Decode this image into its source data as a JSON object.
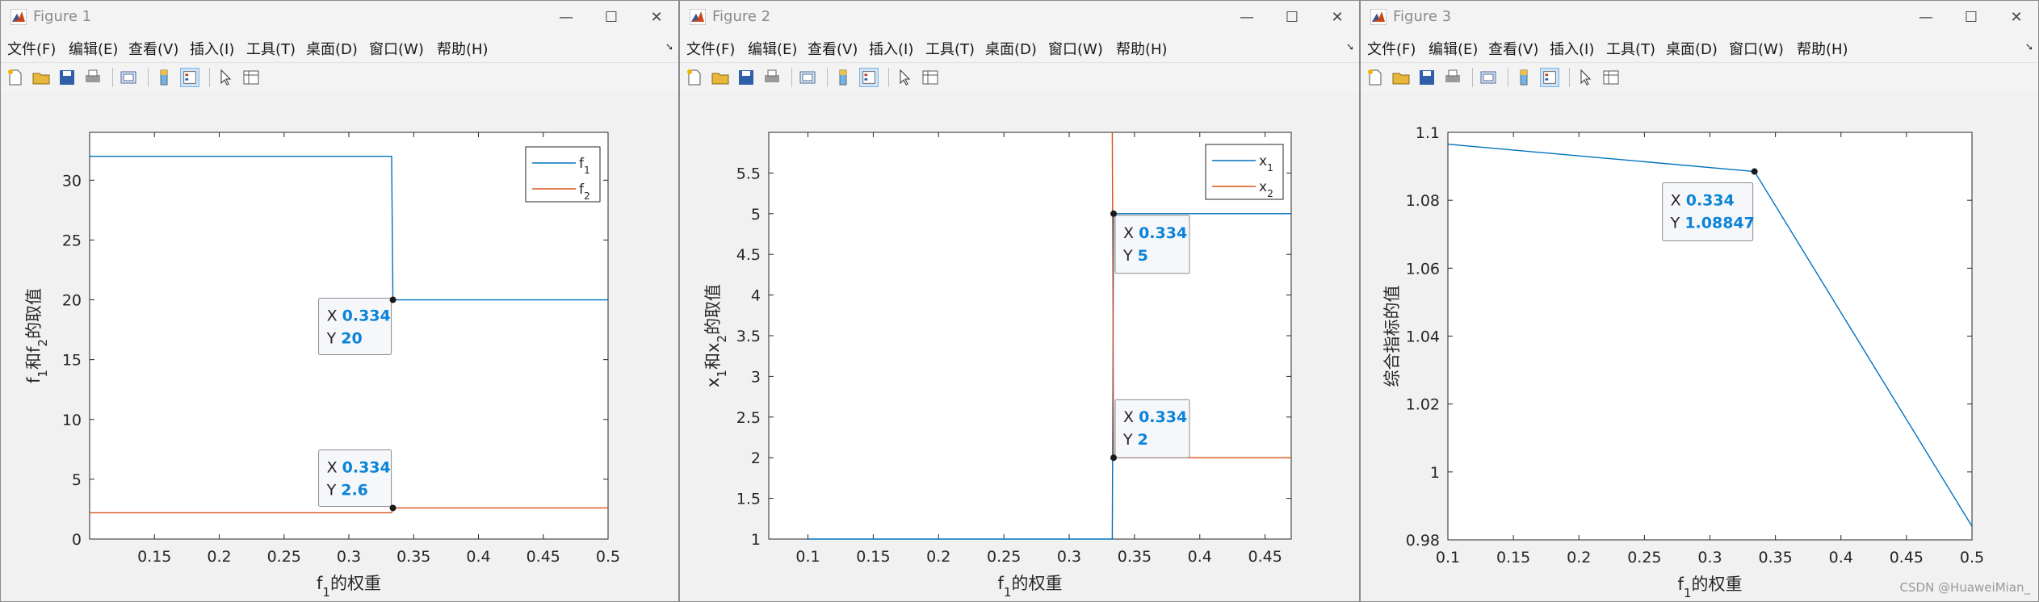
{
  "figures": [
    {
      "title": "Figure 1",
      "menu": [
        "文件(F)",
        "编辑(E)",
        "查看(V)",
        "插入(I)",
        "工具(T)",
        "桌面(D)",
        "窗口(W)",
        "帮助(H)"
      ],
      "xlabel_main": "f",
      "xlabel_sub": "1",
      "xlabel_rest": "的权重",
      "ylabel_parts": [
        [
          "f",
          "1"
        ],
        [
          "和f",
          "2"
        ],
        [
          "的取值",
          ""
        ]
      ],
      "legend": [
        [
          "f",
          "1"
        ],
        [
          "f",
          "2"
        ]
      ],
      "tips": [
        {
          "x_label": "X",
          "x_value": "0.334",
          "y_label": "Y",
          "y_value": "20"
        },
        {
          "x_label": "X",
          "x_value": "0.334",
          "y_label": "Y",
          "y_value": "2.6"
        }
      ]
    },
    {
      "title": "Figure 2",
      "menu": [
        "文件(F)",
        "编辑(E)",
        "查看(V)",
        "插入(I)",
        "工具(T)",
        "桌面(D)",
        "窗口(W)",
        "帮助(H)"
      ],
      "xlabel_main": "f",
      "xlabel_sub": "1",
      "xlabel_rest": "的权重",
      "ylabel_parts": [
        [
          "x",
          "1"
        ],
        [
          "和x",
          "2"
        ],
        [
          "的取值",
          ""
        ]
      ],
      "legend": [
        [
          "x",
          "1"
        ],
        [
          "x",
          "2"
        ]
      ],
      "tips": [
        {
          "x_label": "X",
          "x_value": "0.334",
          "y_label": "Y",
          "y_value": "5"
        },
        {
          "x_label": "X",
          "x_value": "0.334",
          "y_label": "Y",
          "y_value": "2"
        }
      ]
    },
    {
      "title": "Figure 3",
      "menu": [
        "文件(F)",
        "编辑(E)",
        "查看(V)",
        "插入(I)",
        "工具(T)",
        "桌面(D)",
        "窗口(W)",
        "帮助(H)"
      ],
      "xlabel_main": "f",
      "xlabel_sub": "1",
      "xlabel_rest": "的权重",
      "ylabel_parts": [
        [
          "综合指标的值",
          ""
        ]
      ],
      "legend": [],
      "tips": [
        {
          "x_label": "X",
          "x_value": "0.334",
          "y_label": "Y",
          "y_value": "1.08847"
        }
      ]
    }
  ],
  "colors": {
    "series1": "#0072BD",
    "series2": "#D95319",
    "tip_value": "#0a84d8"
  },
  "watermark": "CSDN @HuaweiMian_",
  "chart_data": [
    {
      "type": "line",
      "xlim": [
        0.1,
        0.5
      ],
      "ylim": [
        0,
        34
      ],
      "xticks": [
        "0.15",
        "0.2",
        "0.25",
        "0.3",
        "0.35",
        "0.4",
        "0.45",
        "0.5"
      ],
      "yticks": [
        "0",
        "5",
        "10",
        "15",
        "20",
        "25",
        "30"
      ],
      "legend_position": "top-right",
      "series": [
        {
          "name": "f1",
          "x": [
            0.1,
            0.333,
            0.334,
            0.5
          ],
          "y": [
            32,
            32,
            20,
            20
          ]
        },
        {
          "name": "f2",
          "x": [
            0.1,
            0.333,
            0.334,
            0.5
          ],
          "y": [
            2.2,
            2.2,
            2.6,
            2.6
          ]
        }
      ]
    },
    {
      "type": "line",
      "xlim": [
        0.07,
        0.47
      ],
      "ylim": [
        1,
        6
      ],
      "xticks": [
        "0.1",
        "0.15",
        "0.2",
        "0.25",
        "0.3",
        "0.35",
        "0.4",
        "0.45"
      ],
      "yticks": [
        "1",
        "1.5",
        "2",
        "2.5",
        "3",
        "3.5",
        "4",
        "4.5",
        "5",
        "5.5"
      ],
      "legend_position": "top-right",
      "series": [
        {
          "name": "x1",
          "x": [
            0.1,
            0.333,
            0.334,
            0.47
          ],
          "y": [
            1,
            1,
            5,
            5
          ]
        },
        {
          "name": "x2",
          "x": [
            0.333,
            0.334,
            0.47
          ],
          "y": [
            6,
            2,
            2
          ]
        }
      ]
    },
    {
      "type": "line",
      "xlim": [
        0.1,
        0.5
      ],
      "ylim": [
        0.98,
        1.1
      ],
      "xticks": [
        "0.1",
        "0.15",
        "0.2",
        "0.25",
        "0.3",
        "0.35",
        "0.4",
        "0.45",
        "0.5"
      ],
      "yticks": [
        "0.98",
        "1",
        "1.02",
        "1.04",
        "1.06",
        "1.08",
        "1.1"
      ],
      "series": [
        {
          "x": [
            0.1,
            0.334,
            0.5
          ],
          "y": [
            1.0965,
            1.08847,
            0.984
          ]
        }
      ]
    }
  ]
}
